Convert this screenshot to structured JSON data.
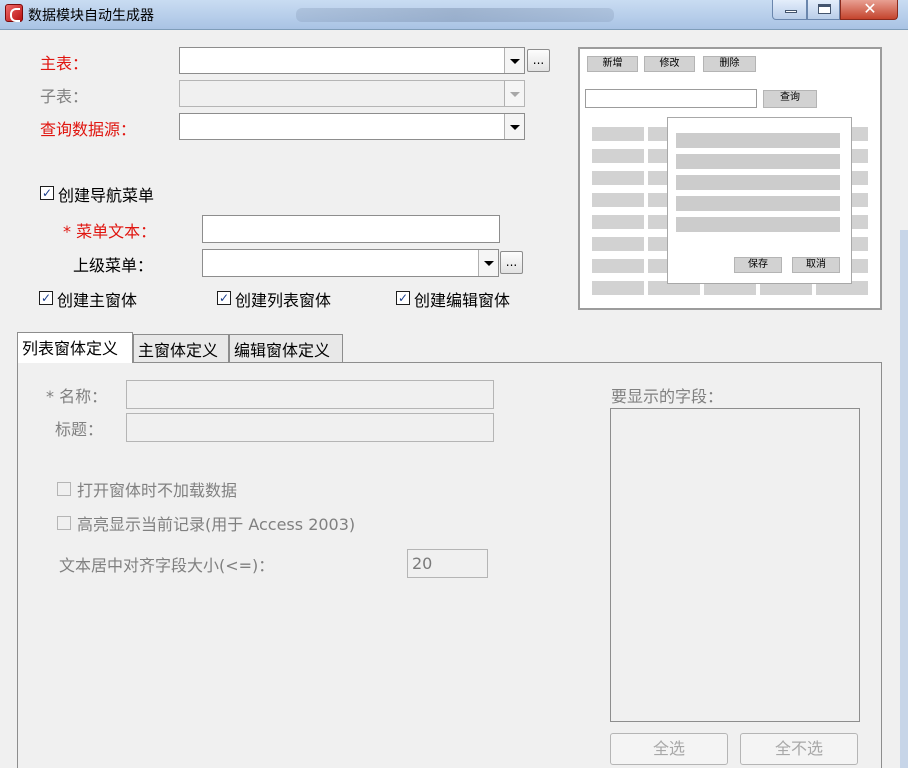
{
  "window": {
    "title": "数据模块自动生成器",
    "controls": [
      "minimize-icon",
      "maximize-icon",
      "close-icon"
    ],
    "close_glyph": "✕"
  },
  "form": {
    "main_table_label": "主表：",
    "sub_table_label": "子表：",
    "query_source_label": "查询数据源：",
    "ellipsis_label": "...",
    "create_nav_menu_label": "创建导航菜单",
    "menu_text_label": "* 菜单文本：",
    "parent_menu_label": "上级菜单：",
    "create_main_form_label": "创建主窗体",
    "create_list_form_label": "创建列表窗体",
    "create_edit_form_label": "创建编辑窗体",
    "check_glyph": "✓"
  },
  "preview": {
    "new_label": "新增",
    "edit_label": "修改",
    "delete_label": "删除",
    "query_label": "查询",
    "save_label": "保存",
    "cancel_label": "取消"
  },
  "tabs": [
    {
      "label": "列表窗体定义",
      "active": true
    },
    {
      "label": "主窗体定义",
      "active": false
    },
    {
      "label": "编辑窗体定义",
      "active": false
    }
  ],
  "list_tab": {
    "name_label": "* 名称：",
    "title_label": "标题：",
    "no_load_label": "打开窗体时不加载数据",
    "highlight_label": "高亮显示当前记录(用于 Access 2003)",
    "center_size_label": "文本居中对齐字段大小(<=)：",
    "center_size_value": "20",
    "fields_label": "要显示的字段：",
    "select_all_label": "全选",
    "select_none_label": "全不选"
  },
  "colors": {
    "required_label": "#e0150f",
    "disabled_text": "#808080"
  }
}
